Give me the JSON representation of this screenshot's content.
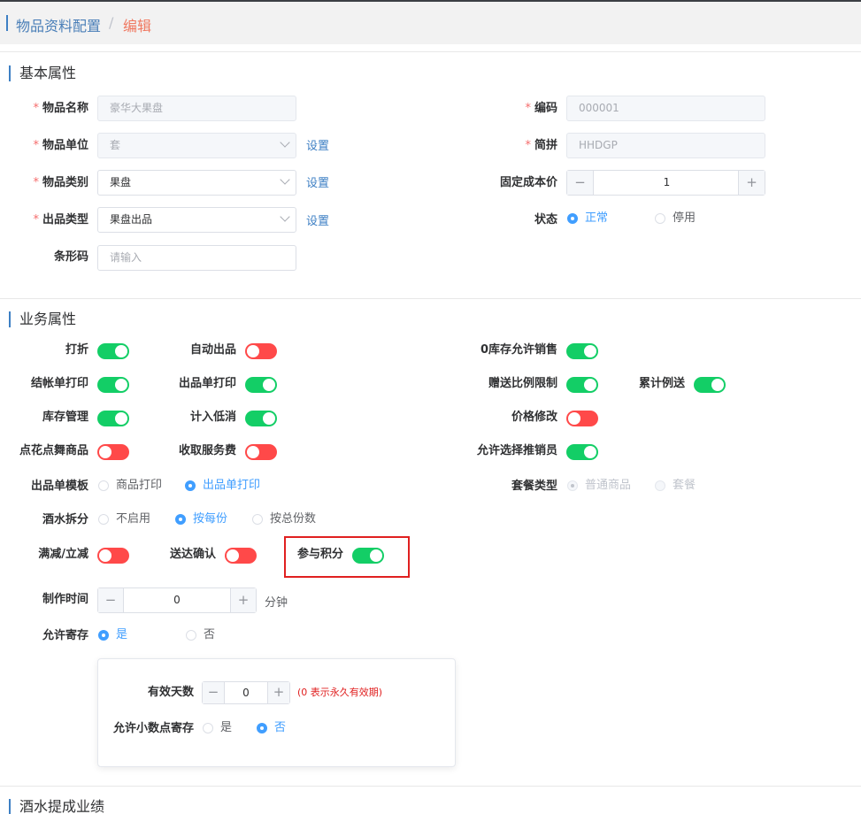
{
  "breadcrumb": {
    "parent": "物品资料配置",
    "separator": "/",
    "current": "编辑"
  },
  "basic": {
    "title": "基本属性",
    "name": {
      "label": "物品名称",
      "value": "豪华大果盘"
    },
    "code": {
      "label": "编码",
      "value": "000001"
    },
    "unit": {
      "label": "物品单位",
      "value": "套",
      "link": "设置"
    },
    "pinyin": {
      "label": "简拼",
      "value": "HHDGP"
    },
    "category": {
      "label": "物品类别",
      "value": "果盘",
      "link": "设置"
    },
    "cost": {
      "label": "固定成本价",
      "value": "1",
      "minus": "−",
      "plus": "+"
    },
    "out_type": {
      "label": "出品类型",
      "value": "果盘出品",
      "link": "设置"
    },
    "status": {
      "label": "状态",
      "options": [
        "正常",
        "停用"
      ],
      "selected": "正常"
    },
    "barcode": {
      "label": "条形码",
      "placeholder": "请输入"
    }
  },
  "business": {
    "title": "业务属性",
    "switches": {
      "discount": {
        "label": "打折",
        "on": true
      },
      "auto_out": {
        "label": "自动出品",
        "on": false
      },
      "zero_stock": {
        "label": "0库存允许销售",
        "on": true
      },
      "bill_print": {
        "label": "结帐单打印",
        "on": true
      },
      "out_print": {
        "label": "出品单打印",
        "on": true
      },
      "gift_ratio": {
        "label": "赠送比例限制",
        "on": true
      },
      "accum_gift": {
        "label": "累计例送",
        "on": true
      },
      "stock_mgmt": {
        "label": "库存管理",
        "on": true
      },
      "low_consume": {
        "label": "计入低消",
        "on": true
      },
      "price_edit": {
        "label": "价格修改",
        "on": false
      },
      "dance": {
        "label": "点花点舞商品",
        "on": false
      },
      "service_fee": {
        "label": "收取服务费",
        "on": false
      },
      "choose_sales": {
        "label": "允许选择推销员",
        "on": true
      },
      "reduce": {
        "label": "满减/立减",
        "on": false
      },
      "deliver_confirm": {
        "label": "送达确认",
        "on": false
      },
      "points": {
        "label": "参与积分",
        "on": true
      }
    },
    "out_template": {
      "label": "出品单模板",
      "options": [
        "商品打印",
        "出品单打印"
      ],
      "selected": "出品单打印"
    },
    "package_type": {
      "label": "套餐类型",
      "options": [
        "普通商品",
        "套餐"
      ],
      "selected": "普通商品"
    },
    "wine_split": {
      "label": "酒水拆分",
      "options": [
        "不启用",
        "按每份",
        "按总份数"
      ],
      "selected": "按每份"
    },
    "make_time": {
      "label": "制作时间",
      "value": "0",
      "unit": "分钟",
      "minus": "−",
      "plus": "+"
    },
    "storage": {
      "label": "允许寄存",
      "options": [
        "是",
        "否"
      ],
      "selected": "是"
    },
    "storage_panel": {
      "valid_days": {
        "label": "有效天数",
        "value": "0",
        "hint": "(0 表示永久有效期)",
        "minus": "−",
        "plus": "+"
      },
      "decimal": {
        "label": "允许小数点寄存",
        "options": [
          "是",
          "否"
        ],
        "selected": "否"
      }
    }
  },
  "commission": {
    "title": "酒水提成业绩"
  }
}
